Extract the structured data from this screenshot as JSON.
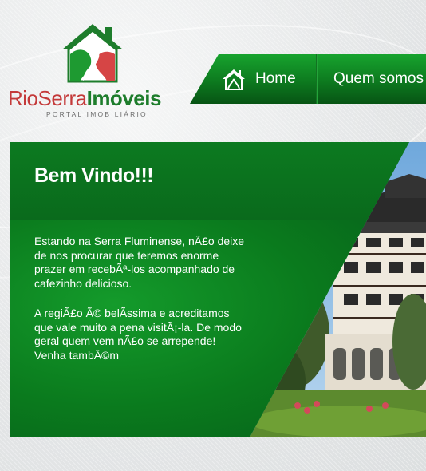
{
  "brand": {
    "name_part1": "RioSerra",
    "name_part2": "Imóveis",
    "tagline": "PORTAL IMOBILIÁRIO"
  },
  "nav": {
    "items": [
      {
        "label": "Home",
        "icon": "house-icon"
      },
      {
        "label": "Quem somos"
      }
    ]
  },
  "banner": {
    "heading": "Bem Vindo!!!",
    "paragraph1": "Estando na Serra Fluminense, nÃ£o deixe de nos procurar que teremos enorme prazer em recebÃª-los acompanhado de cafezinho delicioso.",
    "paragraph2": "A regiÃ£o Ã© belÃssima e acreditamos que vale muito a pena visitÃ¡-la. De modo geral quem vem nÃ£o se arrepende! Venha tambÃ©m"
  },
  "colors": {
    "brand_red": "#c43a3a",
    "brand_green": "#1e7d2c",
    "nav_green": "#0d7a1f",
    "panel_green": "#0a7a1d"
  }
}
